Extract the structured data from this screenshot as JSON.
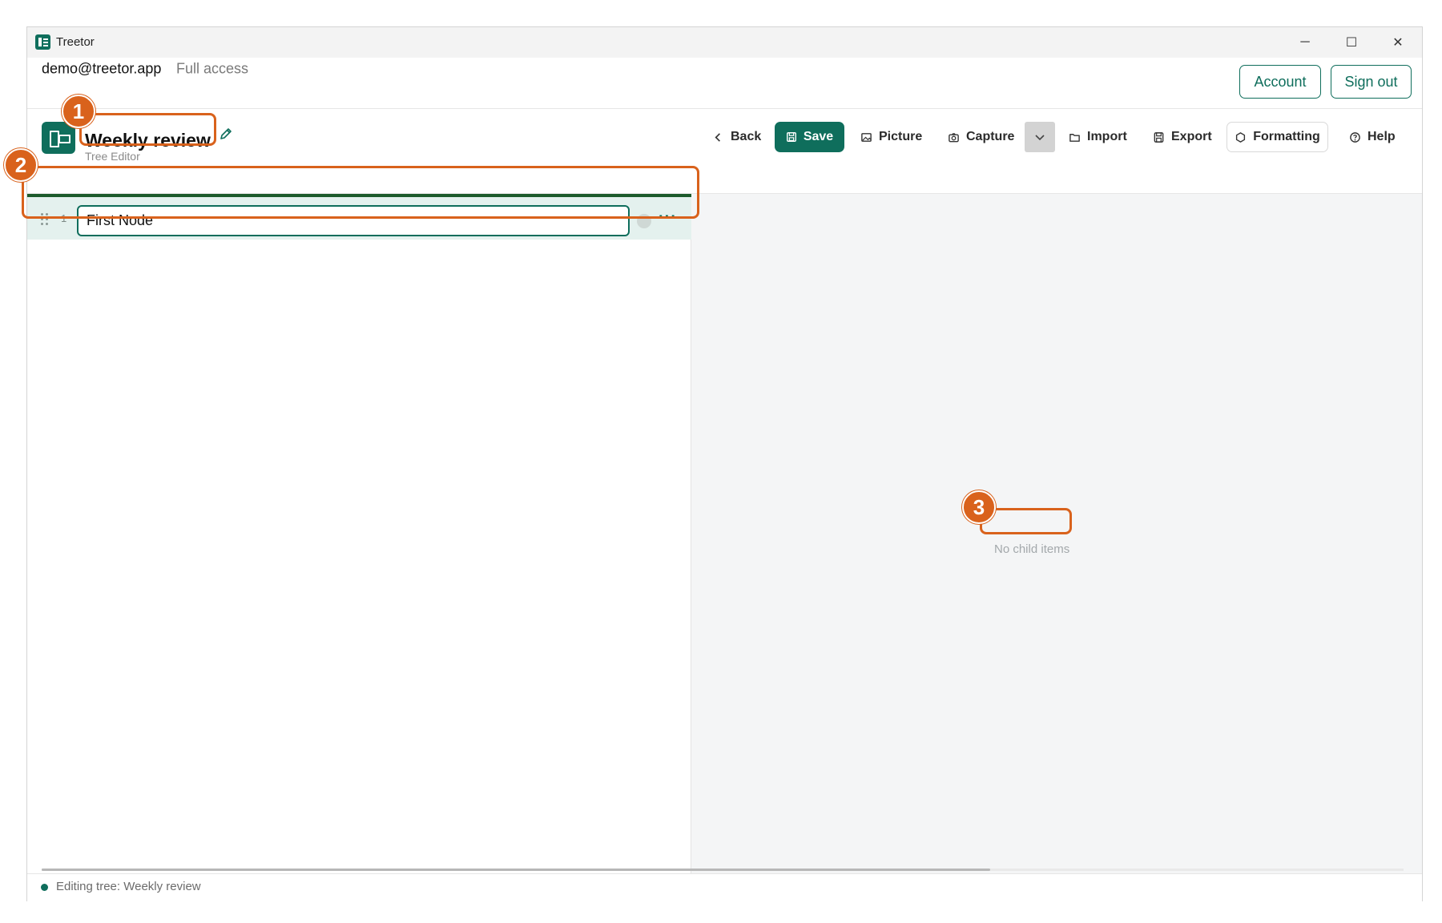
{
  "window": {
    "title": "Treetor",
    "controls": {
      "minimize": "─",
      "maximize": "☐",
      "close": "✕"
    }
  },
  "account": {
    "email": "demo@treetor.app",
    "access": "Full access",
    "account_label": "Account",
    "signout_label": "Sign out"
  },
  "document": {
    "title": "Weekly review",
    "subtitle": "Tree Editor"
  },
  "toolbar": {
    "back": "Back",
    "save": "Save",
    "picture": "Picture",
    "capture": "Capture",
    "import": "Import",
    "export": "Export",
    "formatting": "Formatting",
    "help": "Help"
  },
  "tree": {
    "nodes": [
      {
        "number": "1",
        "value": "First Node"
      }
    ]
  },
  "detail": {
    "empty_message": "No child items"
  },
  "status": {
    "text": "Editing tree: Weekly review"
  },
  "annotations": [
    {
      "label": "1"
    },
    {
      "label": "2"
    },
    {
      "label": "3"
    }
  ],
  "colors": {
    "accent": "#0f6e5c",
    "annotation": "#d9621c",
    "row_highlight": "#e4f1ee",
    "detail_bg": "#f4f5f6"
  }
}
